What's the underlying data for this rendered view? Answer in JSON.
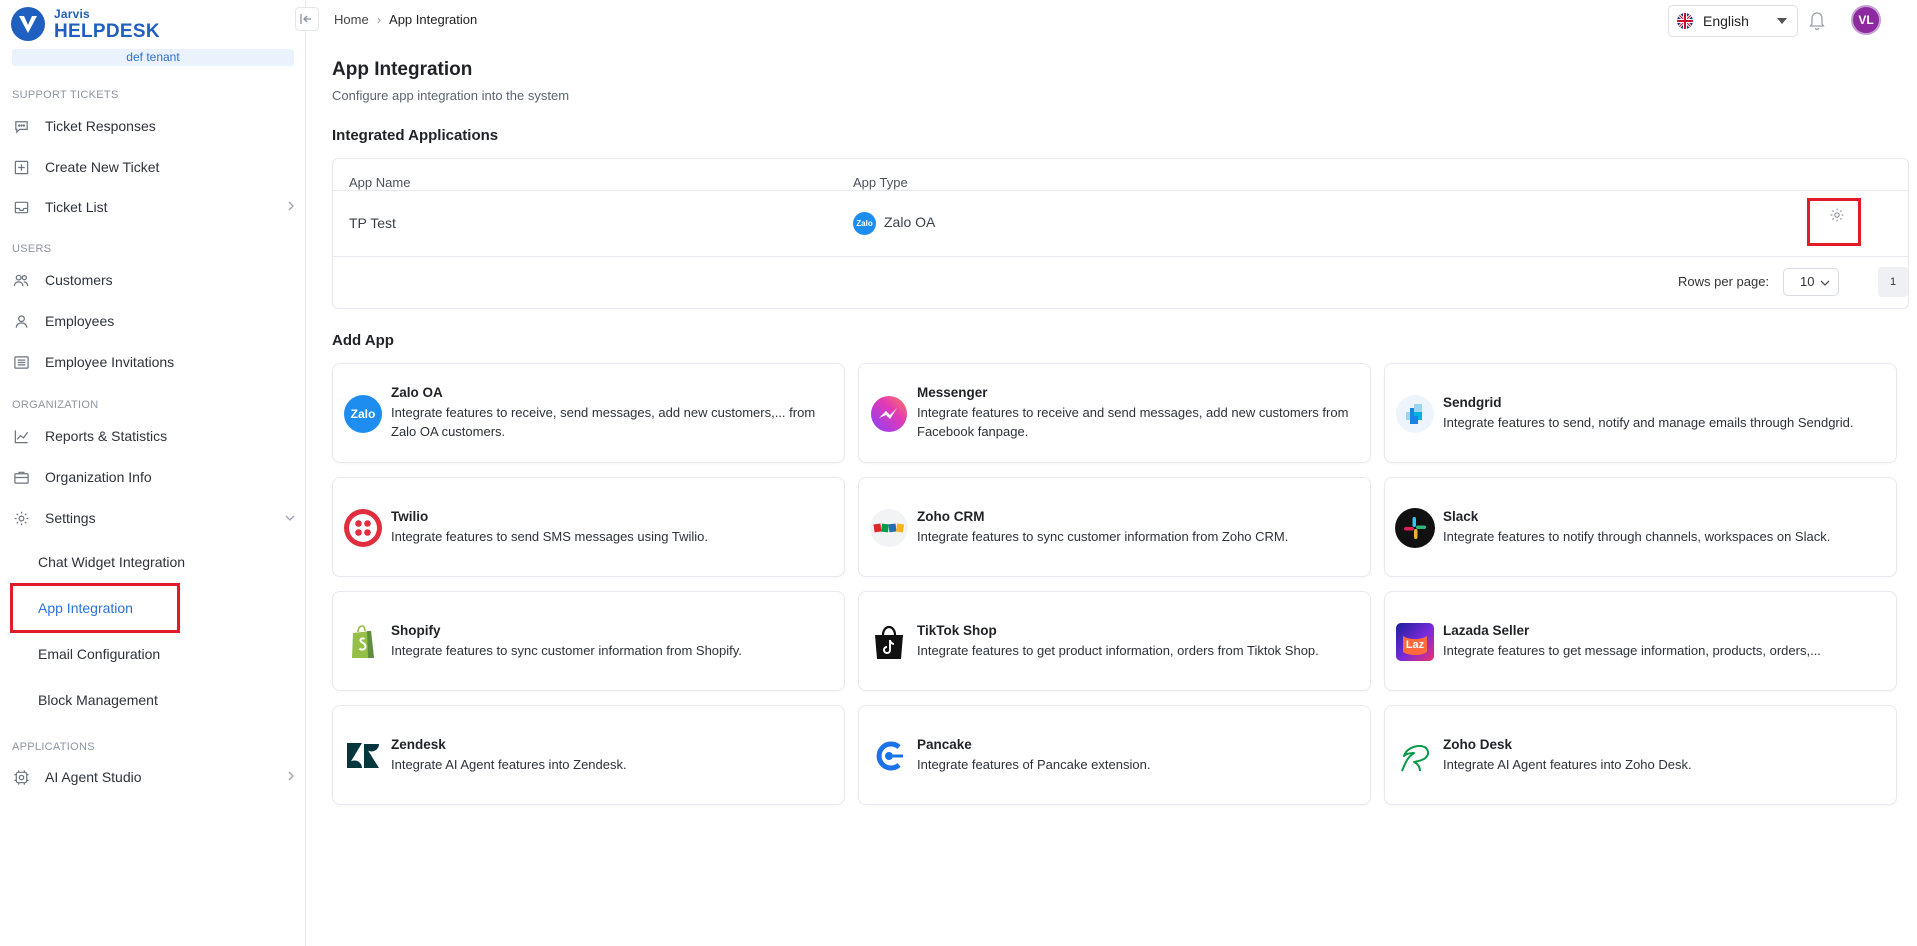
{
  "brand": {
    "small": "Jarvis",
    "big": "HELPDESK",
    "tenant": "def tenant"
  },
  "sidebar": {
    "sections": [
      {
        "title": "SUPPORT TICKETS"
      },
      {
        "title": "USERS"
      },
      {
        "title": "ORGANIZATION"
      },
      {
        "title": "APPLICATIONS"
      }
    ],
    "items": [
      {
        "label": "Ticket Responses",
        "icon": "chat-bubble-icon"
      },
      {
        "label": "Create New Ticket",
        "icon": "plus-square-icon"
      },
      {
        "label": "Ticket List",
        "icon": "inbox-icon"
      },
      {
        "label": "Customers",
        "icon": "users-icon"
      },
      {
        "label": "Employees",
        "icon": "user-icon"
      },
      {
        "label": "Employee Invitations",
        "icon": "list-icon"
      },
      {
        "label": "Reports & Statistics",
        "icon": "chart-line-icon"
      },
      {
        "label": "Organization Info",
        "icon": "briefcase-icon"
      },
      {
        "label": "Settings",
        "icon": "gear-icon"
      },
      {
        "label": "AI Agent Studio",
        "icon": "cpu-icon"
      }
    ],
    "settings_sub": [
      {
        "label": "Chat Widget Integration"
      },
      {
        "label": "App Integration",
        "active": true
      },
      {
        "label": "Email Configuration"
      },
      {
        "label": "Block Management"
      }
    ]
  },
  "breadcrumb": {
    "home": "Home",
    "current": "App Integration"
  },
  "topbar": {
    "language": "English",
    "avatar_initials": "VL"
  },
  "page": {
    "title": "App Integration",
    "subtitle": "Configure app integration into the system",
    "integrated_heading": "Integrated Applications",
    "add_heading": "Add App"
  },
  "table": {
    "columns": [
      "App Name",
      "App Type"
    ],
    "rows": [
      {
        "app_name": "TP Test",
        "app_type": "Zalo OA"
      }
    ],
    "rows_per_page_label": "Rows per page:",
    "rows_per_page": "10",
    "page": "1"
  },
  "apps": [
    {
      "name": "Zalo OA",
      "desc": "Integrate features to receive, send messages, add new customers,... from Zalo OA customers.",
      "icon": "zalo-icon"
    },
    {
      "name": "Messenger",
      "desc": "Integrate features to receive and send messages, add new customers from Facebook fanpage.",
      "icon": "messenger-icon"
    },
    {
      "name": "Sendgrid",
      "desc": "Integrate features to send, notify and manage emails through Sendgrid.",
      "icon": "sendgrid-icon"
    },
    {
      "name": "Twilio",
      "desc": "Integrate features to send SMS messages using Twilio.",
      "icon": "twilio-icon"
    },
    {
      "name": "Zoho CRM",
      "desc": "Integrate features to sync customer information from Zoho CRM.",
      "icon": "zoho-icon"
    },
    {
      "name": "Slack",
      "desc": "Integrate features to notify through channels, workspaces on Slack.",
      "icon": "slack-icon"
    },
    {
      "name": "Shopify",
      "desc": "Integrate features to sync customer information from Shopify.",
      "icon": "shopify-icon"
    },
    {
      "name": "TikTok Shop",
      "desc": "Integrate features to get product information, orders from Tiktok Shop.",
      "icon": "tiktok-icon"
    },
    {
      "name": "Lazada Seller",
      "desc": "Integrate features to get message information, products, orders,...",
      "icon": "lazada-icon"
    },
    {
      "name": "Zendesk",
      "desc": "Integrate AI Agent features into Zendesk.",
      "icon": "zendesk-icon"
    },
    {
      "name": "Pancake",
      "desc": "Integrate features of Pancake extension.",
      "icon": "pancake-icon"
    },
    {
      "name": "Zoho Desk",
      "desc": "Integrate AI Agent features into Zoho Desk.",
      "icon": "zoho-desk-icon"
    }
  ],
  "colors": {
    "accent": "#2a72e0",
    "highlight": "#e11b2a",
    "avatar": "#8e2a9f"
  }
}
